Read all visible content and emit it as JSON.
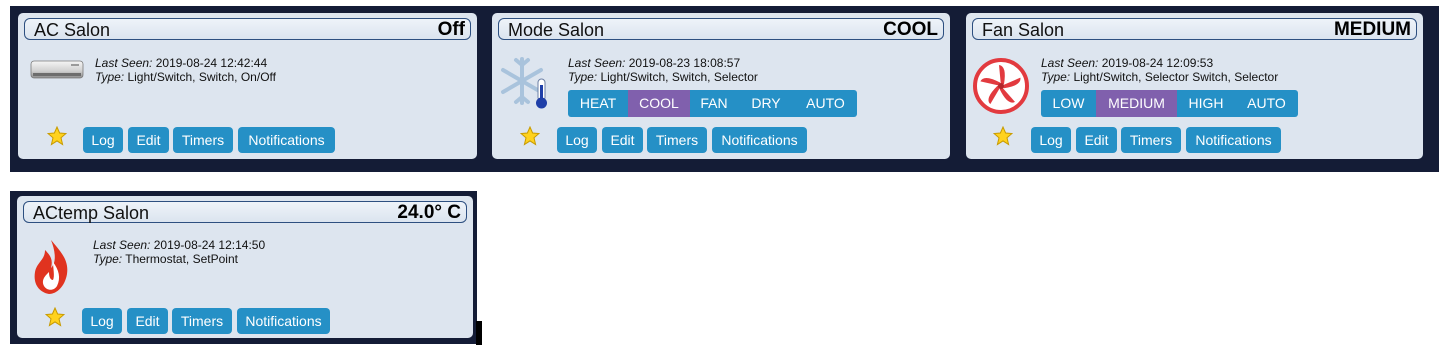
{
  "labels": {
    "last_seen": "Last Seen:",
    "type": "Type:"
  },
  "buttons": {
    "log": "Log",
    "edit": "Edit",
    "timers": "Timers",
    "notifications": "Notifications"
  },
  "devices": [
    {
      "title": "AC Salon",
      "status": "Off",
      "last_seen": "2019-08-24 12:42:44",
      "type": "Light/Switch, Switch, On/Off",
      "icon": "air-conditioner-icon"
    },
    {
      "title": "Mode Salon",
      "status": "COOL",
      "last_seen": "2019-08-23 18:08:57",
      "type": "Light/Switch, Switch, Selector",
      "icon": "snowflake-thermometer-icon",
      "options": [
        "HEAT",
        "COOL",
        "FAN",
        "DRY",
        "AUTO"
      ],
      "selected": "COOL"
    },
    {
      "title": "Fan Salon",
      "status": "MEDIUM",
      "last_seen": "2019-08-24 12:09:53",
      "type": "Light/Switch, Selector Switch, Selector",
      "icon": "fan-icon",
      "options": [
        "LOW",
        "MEDIUM",
        "HIGH",
        "AUTO"
      ],
      "selected": "MEDIUM"
    },
    {
      "title": "ACtemp Salon",
      "status": "24.0° C",
      "last_seen": "2019-08-24 12:14:50",
      "type": "Thermostat, SetPoint",
      "icon": "flame-icon"
    }
  ],
  "colors": {
    "background_band": "#141c36",
    "card": "#dde5ef",
    "button": "#2590c6",
    "selected": "#8060ad"
  }
}
